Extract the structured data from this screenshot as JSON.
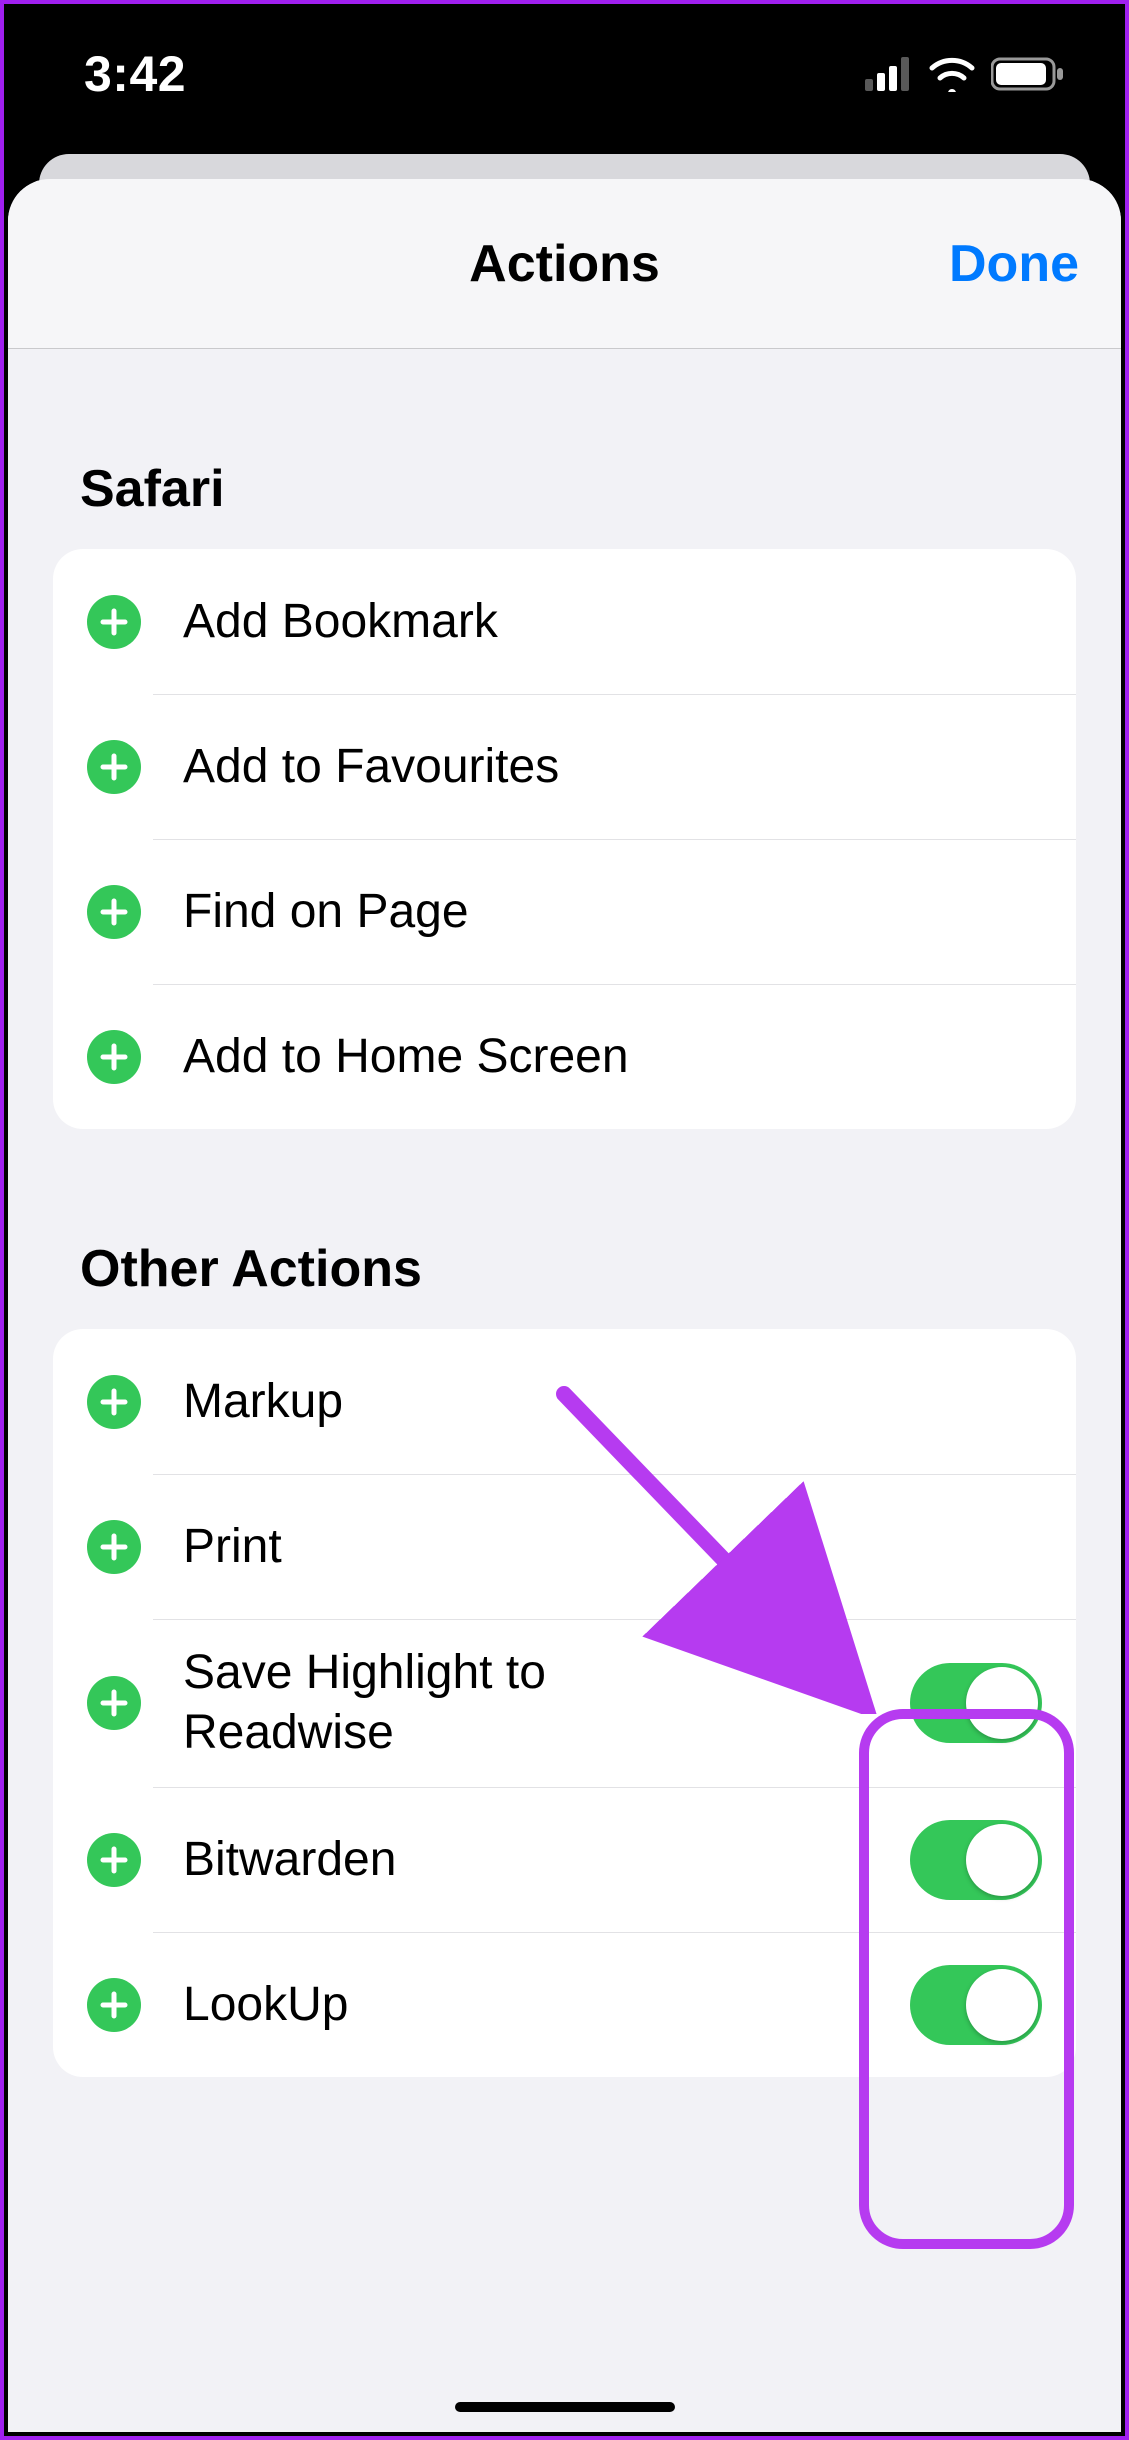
{
  "status": {
    "time": "3:42"
  },
  "header": {
    "title": "Actions",
    "done": "Done"
  },
  "sections": {
    "safari": {
      "title": "Safari",
      "items": [
        {
          "label": "Add Bookmark"
        },
        {
          "label": "Add to Favourites"
        },
        {
          "label": "Find on Page"
        },
        {
          "label": "Add to Home Screen"
        }
      ]
    },
    "other": {
      "title": "Other Actions",
      "items": [
        {
          "label": "Markup",
          "toggle": false
        },
        {
          "label": "Print",
          "toggle": false
        },
        {
          "label": "Save Highlight to Readwise",
          "toggle": true
        },
        {
          "label": "Bitwarden",
          "toggle": true
        },
        {
          "label": "LookUp",
          "toggle": true
        }
      ]
    }
  },
  "annotation": {
    "color": "#b63bf0"
  }
}
